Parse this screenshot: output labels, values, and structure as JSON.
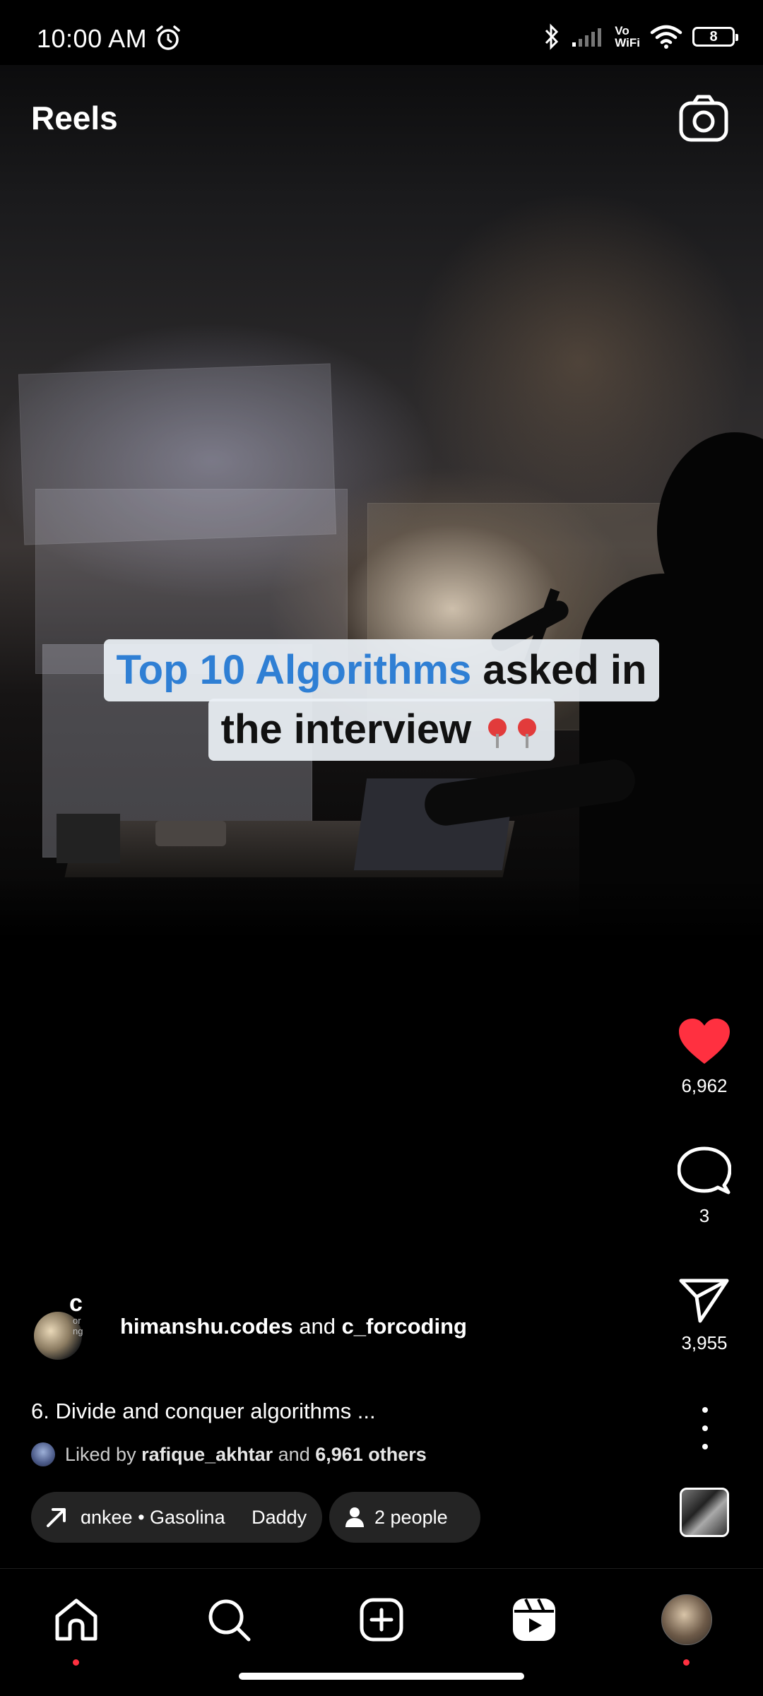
{
  "status_bar": {
    "time": "10:00 AM",
    "vowifi_top": "Vo",
    "vowifi_bottom": "WiFi",
    "battery": "8",
    "icons": [
      "alarm-icon",
      "bluetooth-icon",
      "signal-icon",
      "vowifi-icon",
      "wifi-icon",
      "battery-icon"
    ]
  },
  "header": {
    "title": "Reels",
    "camera_icon": "camera-icon"
  },
  "video": {
    "overlay_line1_highlight": "Top 10 Algorithms",
    "overlay_line1_rest": " asked in",
    "overlay_line2": "the interview",
    "overlay_emoji": "pushpin-icon"
  },
  "actions": {
    "likes": "6,962",
    "comments": "3",
    "shares": "3,955",
    "liked": true,
    "like_color": "#ff3040"
  },
  "author": {
    "avatar_letter": "c",
    "avatar_sub": "or\nng",
    "name1": "himanshu.codes",
    "joiner": " and ",
    "name2": "c_forcoding"
  },
  "caption": "6. Divide and conquer algorithms ...",
  "liked_by": {
    "prefix": "Liked by ",
    "user": "rafique_akhtar",
    "middle": " and ",
    "others": "6,961 others"
  },
  "chips": {
    "music": "ɑnkee • Gasolina     Daddy",
    "people": "2 people"
  },
  "nav": {
    "items": [
      "home-icon",
      "search-icon",
      "create-icon",
      "reels-icon",
      "profile-avatar"
    ],
    "notification_color": "#ff3040"
  }
}
